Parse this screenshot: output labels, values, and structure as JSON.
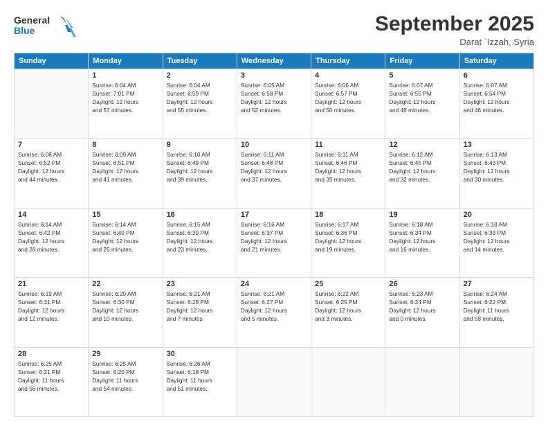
{
  "header": {
    "logo": {
      "line1": "General",
      "line2": "Blue"
    },
    "title": "September 2025",
    "subtitle": "Darat `Izzah, Syria"
  },
  "days_of_week": [
    "Sunday",
    "Monday",
    "Tuesday",
    "Wednesday",
    "Thursday",
    "Friday",
    "Saturday"
  ],
  "weeks": [
    [
      {
        "day": "",
        "info": ""
      },
      {
        "day": "1",
        "info": "Sunrise: 6:04 AM\nSunset: 7:01 PM\nDaylight: 12 hours\nand 57 minutes."
      },
      {
        "day": "2",
        "info": "Sunrise: 6:04 AM\nSunset: 6:59 PM\nDaylight: 12 hours\nand 55 minutes."
      },
      {
        "day": "3",
        "info": "Sunrise: 6:05 AM\nSunset: 6:58 PM\nDaylight: 12 hours\nand 52 minutes."
      },
      {
        "day": "4",
        "info": "Sunrise: 6:06 AM\nSunset: 6:57 PM\nDaylight: 12 hours\nand 50 minutes."
      },
      {
        "day": "5",
        "info": "Sunrise: 6:07 AM\nSunset: 6:55 PM\nDaylight: 12 hours\nand 48 minutes."
      },
      {
        "day": "6",
        "info": "Sunrise: 6:07 AM\nSunset: 6:54 PM\nDaylight: 12 hours\nand 46 minutes."
      }
    ],
    [
      {
        "day": "7",
        "info": "Sunrise: 6:08 AM\nSunset: 6:52 PM\nDaylight: 12 hours\nand 44 minutes."
      },
      {
        "day": "8",
        "info": "Sunrise: 6:09 AM\nSunset: 6:51 PM\nDaylight: 12 hours\nand 41 minutes."
      },
      {
        "day": "9",
        "info": "Sunrise: 6:10 AM\nSunset: 6:49 PM\nDaylight: 12 hours\nand 39 minutes."
      },
      {
        "day": "10",
        "info": "Sunrise: 6:11 AM\nSunset: 6:48 PM\nDaylight: 12 hours\nand 37 minutes."
      },
      {
        "day": "11",
        "info": "Sunrise: 6:11 AM\nSunset: 6:46 PM\nDaylight: 12 hours\nand 35 minutes."
      },
      {
        "day": "12",
        "info": "Sunrise: 6:12 AM\nSunset: 6:45 PM\nDaylight: 12 hours\nand 32 minutes."
      },
      {
        "day": "13",
        "info": "Sunrise: 6:13 AM\nSunset: 6:43 PM\nDaylight: 12 hours\nand 30 minutes."
      }
    ],
    [
      {
        "day": "14",
        "info": "Sunrise: 6:14 AM\nSunset: 6:42 PM\nDaylight: 12 hours\nand 28 minutes."
      },
      {
        "day": "15",
        "info": "Sunrise: 6:14 AM\nSunset: 6:40 PM\nDaylight: 12 hours\nand 25 minutes."
      },
      {
        "day": "16",
        "info": "Sunrise: 6:15 AM\nSunset: 6:39 PM\nDaylight: 12 hours\nand 23 minutes."
      },
      {
        "day": "17",
        "info": "Sunrise: 6:16 AM\nSunset: 6:37 PM\nDaylight: 12 hours\nand 21 minutes."
      },
      {
        "day": "18",
        "info": "Sunrise: 6:17 AM\nSunset: 6:36 PM\nDaylight: 12 hours\nand 19 minutes."
      },
      {
        "day": "19",
        "info": "Sunrise: 6:18 AM\nSunset: 6:34 PM\nDaylight: 12 hours\nand 16 minutes."
      },
      {
        "day": "20",
        "info": "Sunrise: 6:18 AM\nSunset: 6:33 PM\nDaylight: 12 hours\nand 14 minutes."
      }
    ],
    [
      {
        "day": "21",
        "info": "Sunrise: 6:19 AM\nSunset: 6:31 PM\nDaylight: 12 hours\nand 12 minutes."
      },
      {
        "day": "22",
        "info": "Sunrise: 6:20 AM\nSunset: 6:30 PM\nDaylight: 12 hours\nand 10 minutes."
      },
      {
        "day": "23",
        "info": "Sunrise: 6:21 AM\nSunset: 6:28 PM\nDaylight: 12 hours\nand 7 minutes."
      },
      {
        "day": "24",
        "info": "Sunrise: 6:21 AM\nSunset: 6:27 PM\nDaylight: 12 hours\nand 5 minutes."
      },
      {
        "day": "25",
        "info": "Sunrise: 6:22 AM\nSunset: 6:25 PM\nDaylight: 12 hours\nand 3 minutes."
      },
      {
        "day": "26",
        "info": "Sunrise: 6:23 AM\nSunset: 6:24 PM\nDaylight: 12 hours\nand 0 minutes."
      },
      {
        "day": "27",
        "info": "Sunrise: 6:24 AM\nSunset: 6:22 PM\nDaylight: 11 hours\nand 58 minutes."
      }
    ],
    [
      {
        "day": "28",
        "info": "Sunrise: 6:25 AM\nSunset: 6:21 PM\nDaylight: 11 hours\nand 56 minutes."
      },
      {
        "day": "29",
        "info": "Sunrise: 6:25 AM\nSunset: 6:20 PM\nDaylight: 11 hours\nand 54 minutes."
      },
      {
        "day": "30",
        "info": "Sunrise: 6:26 AM\nSunset: 6:18 PM\nDaylight: 11 hours\nand 51 minutes."
      },
      {
        "day": "",
        "info": ""
      },
      {
        "day": "",
        "info": ""
      },
      {
        "day": "",
        "info": ""
      },
      {
        "day": "",
        "info": ""
      }
    ]
  ]
}
